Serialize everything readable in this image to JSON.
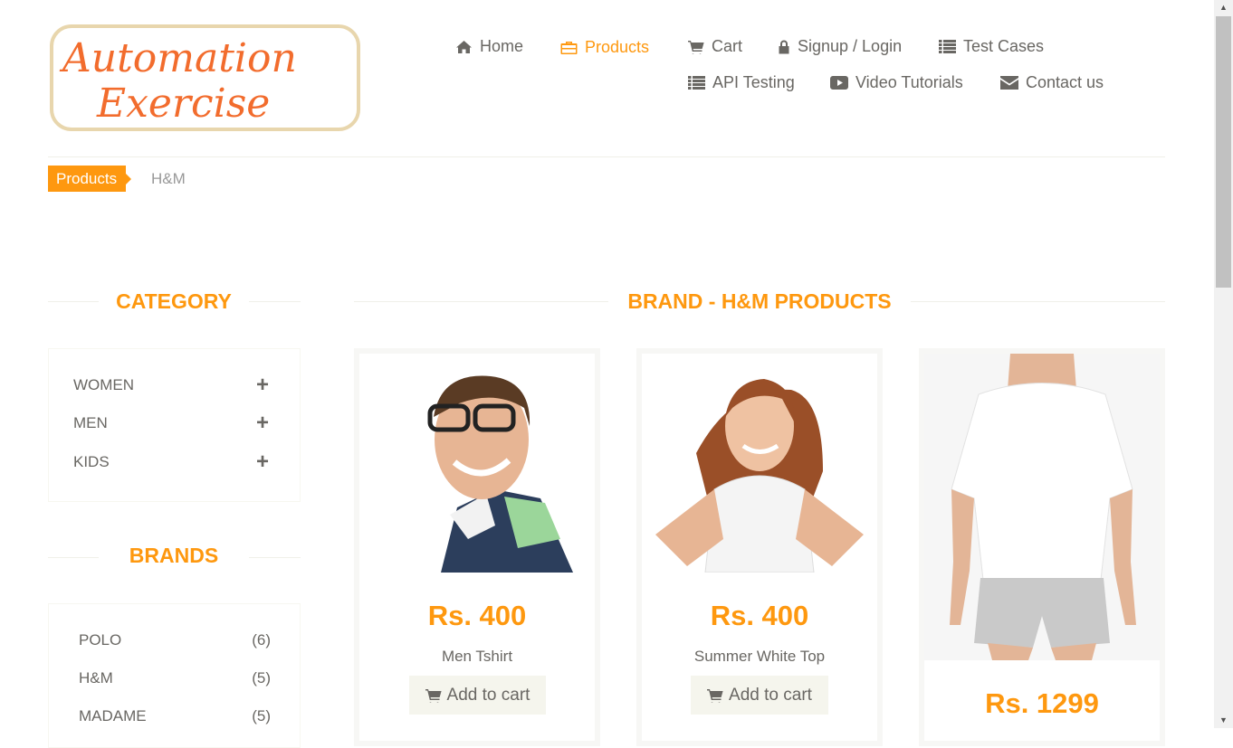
{
  "logo": {
    "line1": "Automation",
    "line2": "Exercise"
  },
  "nav": [
    {
      "label": "Home",
      "icon": "home-icon",
      "active": false
    },
    {
      "label": "Products",
      "icon": "briefcase-icon",
      "active": true
    },
    {
      "label": "Cart",
      "icon": "cart-icon",
      "active": false
    },
    {
      "label": "Signup / Login",
      "icon": "lock-icon",
      "active": false
    },
    {
      "label": "Test Cases",
      "icon": "list-icon",
      "active": false
    },
    {
      "label": "API Testing",
      "icon": "list-icon",
      "active": false
    },
    {
      "label": "Video Tutorials",
      "icon": "youtube-play-icon",
      "active": false
    },
    {
      "label": "Contact us",
      "icon": "envelope-icon",
      "active": false
    }
  ],
  "breadcrumb": {
    "active": "Products",
    "current": "H&M"
  },
  "sidebar": {
    "category_title": "CATEGORY",
    "categories": [
      {
        "label": "WOMEN"
      },
      {
        "label": "MEN"
      },
      {
        "label": "KIDS"
      }
    ],
    "brands_title": "BRANDS",
    "brands": [
      {
        "label": "POLO",
        "count": "(6)"
      },
      {
        "label": "H&M",
        "count": "(5)"
      },
      {
        "label": "MADAME",
        "count": "(5)"
      }
    ]
  },
  "main": {
    "title": "BRAND - H&M PRODUCTS",
    "products": [
      {
        "price": "Rs. 400",
        "name": "Men Tshirt",
        "button": "Add to cart"
      },
      {
        "price": "Rs. 400",
        "name": "Summer White Top",
        "button": "Add to cart"
      },
      {
        "price": "Rs. 1299"
      }
    ]
  },
  "colors": {
    "accent": "#FE980F",
    "text": "#696763",
    "button_bg": "#F5F5ED"
  }
}
